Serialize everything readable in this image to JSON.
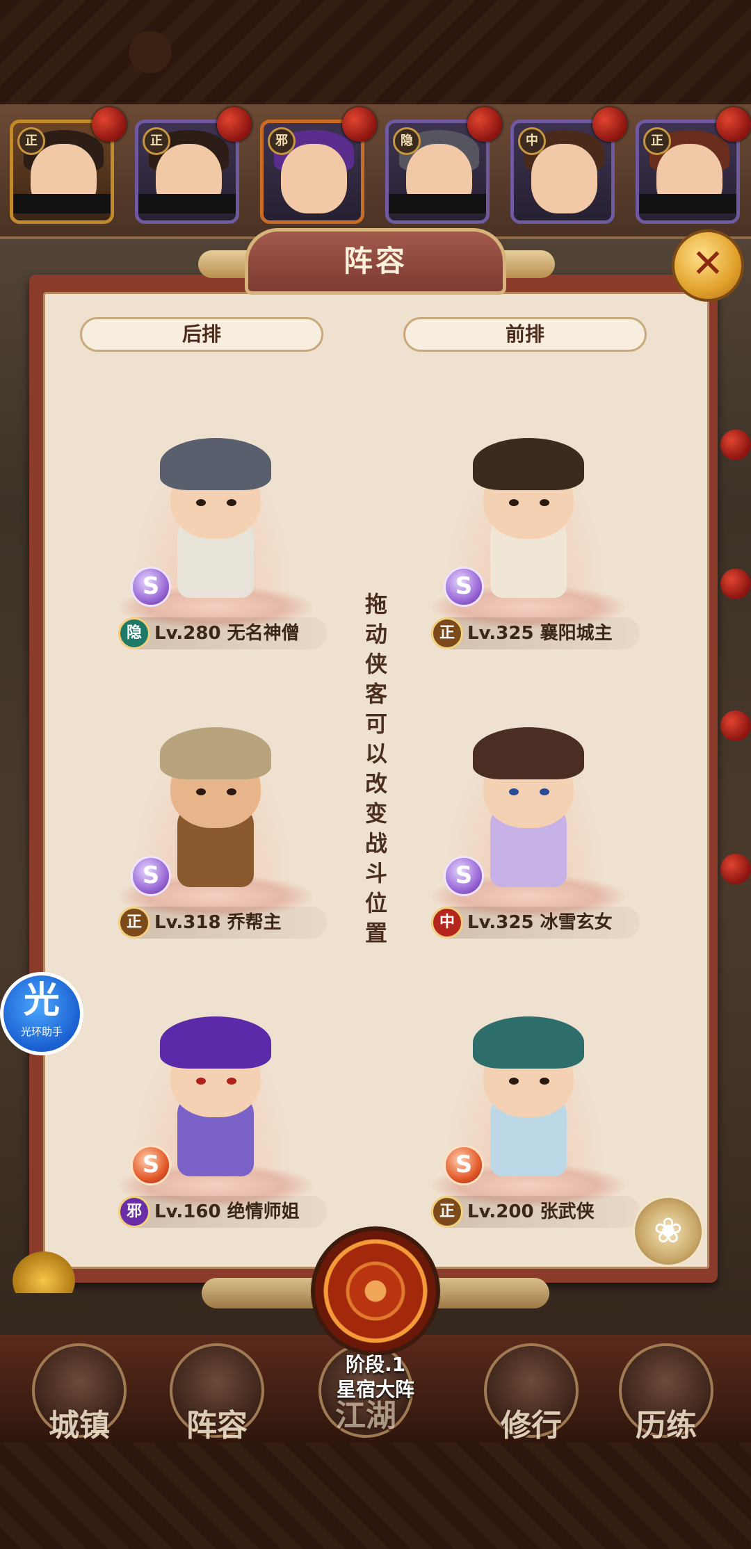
{
  "top_bar": {
    "heroes": [
      {
        "faction": "正"
      },
      {
        "faction": "正"
      },
      {
        "faction": "邪"
      },
      {
        "faction": "隐"
      },
      {
        "faction": "中"
      },
      {
        "faction": "正"
      }
    ]
  },
  "panel": {
    "title": "阵容",
    "close_icon": "close-x-icon",
    "back_row_label": "后排",
    "front_row_label": "前排",
    "hint": "拖动侠客可以改变战斗位置",
    "heroes": [
      {
        "faction": "隐",
        "level_name": "Lv.280 无名神僧",
        "star": "S"
      },
      {
        "faction": "正",
        "level_name": "Lv.325 襄阳城主",
        "star": "S"
      },
      {
        "faction": "正",
        "level_name": "Lv.318 乔帮主",
        "star": "S"
      },
      {
        "faction": "中",
        "level_name": "Lv.325 冰雪玄女",
        "star": "S"
      },
      {
        "faction": "邪",
        "level_name": "Lv.160 绝情师姐",
        "star": "S"
      },
      {
        "faction": "正",
        "level_name": "Lv.200 张武侠",
        "star": "S"
      }
    ]
  },
  "assistant": {
    "big": "光",
    "small": "光环助手"
  },
  "formation": {
    "stage": "阶段.1",
    "name": "星宿大阵"
  },
  "bottom_nav": [
    "城镇",
    "阵容",
    "江湖",
    "修行",
    "历练"
  ]
}
